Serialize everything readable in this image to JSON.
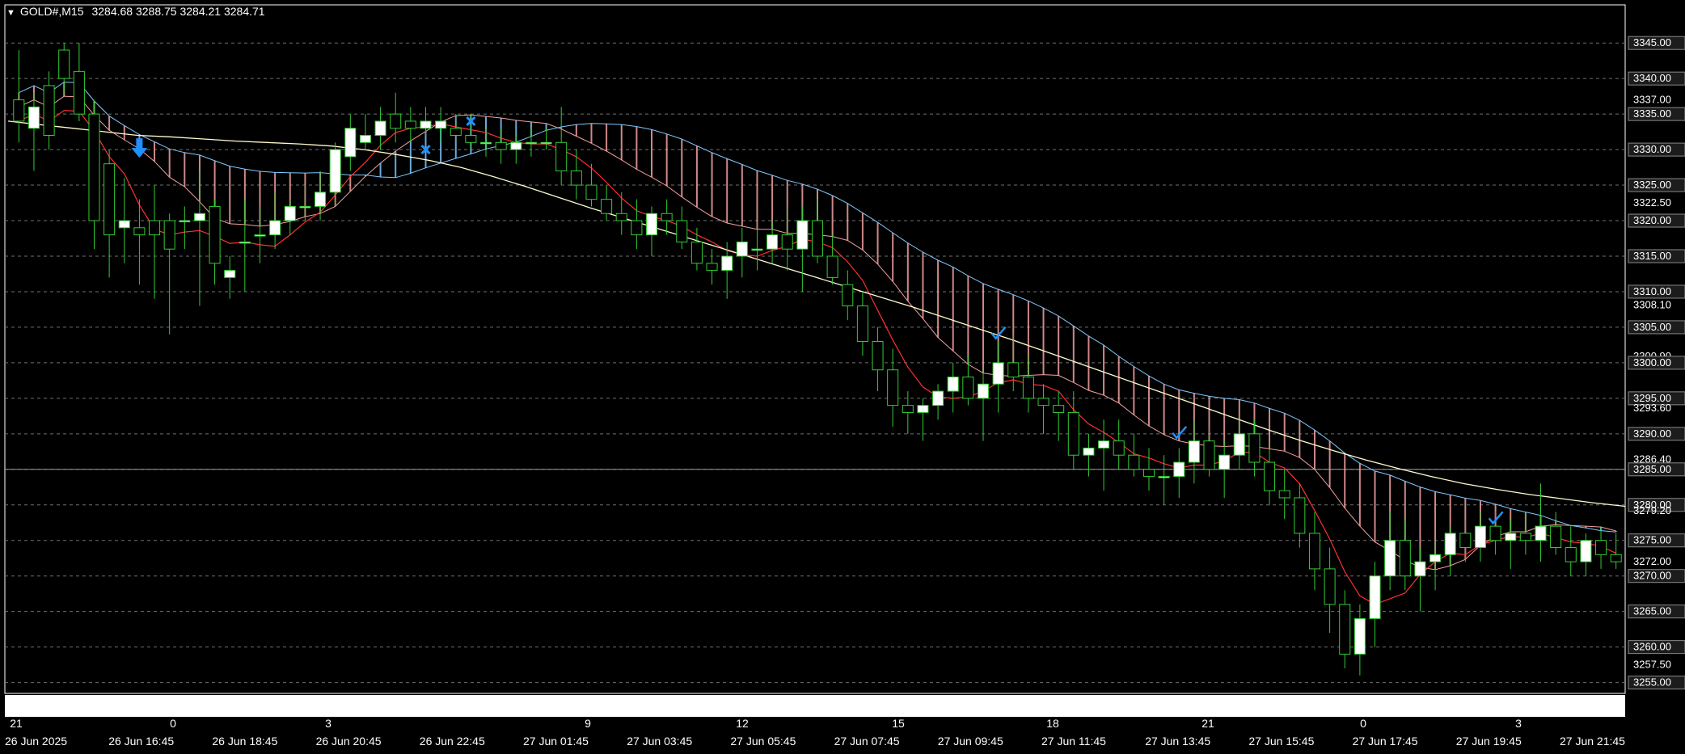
{
  "header": {
    "symbol": "GOLD#,M15",
    "open": "3284.68",
    "high": "3288.75",
    "low": "3284.21",
    "close": "3284.71"
  },
  "colors": {
    "background": "#000000",
    "frame": "#ffffff",
    "grid": "#6f6f6f",
    "bull_body": "#ffffff",
    "bear_body": "#000000",
    "wick": "#32cd32",
    "cloud_bear_fill": "#f4a0a0",
    "cloud_bull_fill": "#7ec8ff",
    "tenkan": "#ff3030",
    "slow_ma": "#fffacd",
    "arrow_signal": "#1e90ff"
  },
  "chart_data": {
    "type": "candlestick",
    "title": "",
    "ylim": [
      3254.5,
      3346.5
    ],
    "price_labels": [
      "3345.00",
      "3340.00",
      "3337.00",
      "3335.00",
      "3330.00",
      "3325.00",
      "3322.50",
      "3320.00",
      "3315.00",
      "3310.00",
      "3308.10",
      "3305.00",
      "3300.90",
      "3300.00",
      "3295.00",
      "3293.60",
      "3290.00",
      "3286.40",
      "3285.00",
      "3280.00",
      "3279.20",
      "3275.00",
      "3272.00",
      "3270.00",
      "3265.00",
      "3260.00",
      "3257.50",
      "3255.00"
    ],
    "grid_levels": [
      3345,
      3340,
      3335,
      3330,
      3325,
      3320,
      3315,
      3310,
      3305,
      3300,
      3295,
      3290,
      3285,
      3280,
      3275,
      3270,
      3265,
      3260,
      3255
    ],
    "current_price": 3285.0,
    "hour_labels": [
      "21",
      "0",
      "3",
      "9",
      "12",
      "15",
      "18",
      "21",
      "0",
      "3"
    ],
    "time_labels": [
      "26 Jun 2025",
      "26 Jun 16:45",
      "26 Jun 18:45",
      "26 Jun 20:45",
      "26 Jun 22:45",
      "27 Jun 01:45",
      "27 Jun 03:45",
      "27 Jun 05:45",
      "27 Jun 07:45",
      "27 Jun 09:45",
      "27 Jun 11:45",
      "27 Jun 13:45",
      "27 Jun 15:45",
      "27 Jun 17:45",
      "27 Jun 19:45",
      "27 Jun 21:45"
    ],
    "candles": [
      [
        3337,
        3344,
        3331,
        3334
      ],
      [
        3333,
        3338,
        3327,
        3336
      ],
      [
        3339,
        3341,
        3330,
        3332
      ],
      [
        3344,
        3345,
        3338,
        3340
      ],
      [
        3341,
        3345,
        3334,
        3335
      ],
      [
        3335,
        3337,
        3316,
        3320
      ],
      [
        3328,
        3330,
        3312,
        3318
      ],
      [
        3319,
        3326,
        3314,
        3320
      ],
      [
        3319,
        3323,
        3311,
        3318
      ],
      [
        3320,
        3325,
        3309,
        3318
      ],
      [
        3320,
        3321,
        3304,
        3316
      ],
      [
        3320,
        3322,
        3316,
        3320
      ],
      [
        3320,
        3327,
        3308,
        3321
      ],
      [
        3322,
        3323,
        3311,
        3314
      ],
      [
        3312,
        3315,
        3309,
        3313
      ],
      [
        3317,
        3323,
        3310,
        3317
      ],
      [
        3318,
        3322,
        3314,
        3318
      ],
      [
        3318,
        3324,
        3316,
        3320
      ],
      [
        3320,
        3323,
        3318,
        3322
      ],
      [
        3322,
        3325,
        3320,
        3322
      ],
      [
        3322,
        3327,
        3320,
        3324
      ],
      [
        3324,
        3331,
        3322,
        3330
      ],
      [
        3329,
        3335,
        3327,
        3333
      ],
      [
        3331,
        3335,
        3330,
        3332
      ],
      [
        3332,
        3336,
        3330,
        3334
      ],
      [
        3335,
        3338,
        3331,
        3333
      ],
      [
        3334,
        3336,
        3331,
        3333
      ],
      [
        3333,
        3336,
        3332,
        3334
      ],
      [
        3333,
        3336,
        3331,
        3334
      ],
      [
        3333,
        3335,
        3331,
        3332
      ],
      [
        3332,
        3335,
        3330,
        3331
      ],
      [
        3331,
        3333,
        3329,
        3331
      ],
      [
        3331,
        3333,
        3328,
        3330
      ],
      [
        3330,
        3332,
        3328,
        3331
      ],
      [
        3331,
        3333,
        3329,
        3331
      ],
      [
        3331,
        3333,
        3330,
        3331
      ],
      [
        3331,
        3336,
        3325,
        3327
      ],
      [
        3327,
        3330,
        3323,
        3325
      ],
      [
        3325,
        3328,
        3322,
        3323
      ],
      [
        3323,
        3325,
        3320,
        3321
      ],
      [
        3321,
        3324,
        3318,
        3320
      ],
      [
        3320,
        3323,
        3316,
        3318
      ],
      [
        3318,
        3322,
        3315,
        3321
      ],
      [
        3321,
        3323,
        3318,
        3320
      ],
      [
        3320,
        3322,
        3316,
        3317
      ],
      [
        3317,
        3319,
        3313,
        3314
      ],
      [
        3314,
        3316,
        3311,
        3313
      ],
      [
        3313,
        3317,
        3309,
        3315
      ],
      [
        3315,
        3319,
        3312,
        3317
      ],
      [
        3316,
        3320,
        3313,
        3316
      ],
      [
        3316,
        3320,
        3314,
        3318
      ],
      [
        3318,
        3322,
        3313,
        3316
      ],
      [
        3316,
        3322,
        3310,
        3320
      ],
      [
        3320,
        3323,
        3314,
        3315
      ],
      [
        3315,
        3318,
        3311,
        3312
      ],
      [
        3311,
        3313,
        3306,
        3308
      ],
      [
        3308,
        3310,
        3301,
        3303
      ],
      [
        3303,
        3305,
        3296,
        3299
      ],
      [
        3299,
        3302,
        3291,
        3294
      ],
      [
        3294,
        3296,
        3290,
        3293
      ],
      [
        3293,
        3295,
        3289,
        3294
      ],
      [
        3294,
        3297,
        3292,
        3296
      ],
      [
        3296,
        3300,
        3293,
        3298
      ],
      [
        3298,
        3301,
        3294,
        3295
      ],
      [
        3295,
        3299,
        3289,
        3297
      ],
      [
        3297,
        3303,
        3293,
        3300
      ],
      [
        3300,
        3304,
        3296,
        3298
      ],
      [
        3298,
        3301,
        3293,
        3295
      ],
      [
        3295,
        3297,
        3290,
        3294
      ],
      [
        3294,
        3296,
        3289,
        3293
      ],
      [
        3293,
        3296,
        3285,
        3287
      ],
      [
        3287,
        3290,
        3284,
        3288
      ],
      [
        3288,
        3292,
        3282,
        3289
      ],
      [
        3289,
        3292,
        3285,
        3287
      ],
      [
        3287,
        3290,
        3284,
        3285
      ],
      [
        3285,
        3288,
        3282,
        3284
      ],
      [
        3284,
        3287,
        3280,
        3284
      ],
      [
        3284,
        3288,
        3281,
        3286
      ],
      [
        3286,
        3292,
        3283,
        3289
      ],
      [
        3289,
        3291,
        3284,
        3285
      ],
      [
        3285,
        3289,
        3281,
        3287
      ],
      [
        3287,
        3292,
        3285,
        3290
      ],
      [
        3290,
        3292,
        3284,
        3286
      ],
      [
        3286,
        3289,
        3280,
        3282
      ],
      [
        3282,
        3285,
        3278,
        3281
      ],
      [
        3281,
        3283,
        3274,
        3276
      ],
      [
        3276,
        3279,
        3268,
        3271
      ],
      [
        3271,
        3274,
        3262,
        3266
      ],
      [
        3266,
        3268,
        3257,
        3259
      ],
      [
        3259,
        3266,
        3256,
        3264
      ],
      [
        3264,
        3272,
        3260,
        3270
      ],
      [
        3270,
        3279,
        3268,
        3275
      ],
      [
        3275,
        3278,
        3268,
        3270
      ],
      [
        3270,
        3274,
        3265,
        3272
      ],
      [
        3272,
        3275,
        3268,
        3273
      ],
      [
        3273,
        3277,
        3270,
        3276
      ],
      [
        3276,
        3278,
        3272,
        3274
      ],
      [
        3274,
        3279,
        3272,
        3277
      ],
      [
        3277,
        3279,
        3273,
        3275
      ],
      [
        3275,
        3278,
        3271,
        3276
      ],
      [
        3276,
        3279,
        3273,
        3275
      ],
      [
        3275,
        3283,
        3272,
        3277
      ],
      [
        3277,
        3279,
        3273,
        3274
      ],
      [
        3274,
        3277,
        3270,
        3272
      ],
      [
        3272,
        3276,
        3270,
        3275
      ],
      [
        3275,
        3277,
        3271,
        3273
      ],
      [
        3273,
        3276,
        3271,
        3272
      ]
    ],
    "slow_ma": [
      3334,
      3333.5,
      3333,
      3332.5,
      3332,
      3331.8,
      3331.5,
      3331.2,
      3331,
      3330.8,
      3330.5,
      3330,
      3329.3,
      3328.5,
      3327.5,
      3326.2,
      3324.8,
      3323.3,
      3321.8,
      3320.4,
      3319,
      3317.6,
      3316.2,
      3314.8,
      3313.4,
      3312,
      3310.6,
      3309.2,
      3307.8,
      3306.3,
      3304.8,
      3303.3,
      3301.7,
      3300.1,
      3298.5,
      3296.9,
      3295.3,
      3293.7,
      3292.1,
      3290.5,
      3289,
      3287.6,
      3286.3,
      3285.1,
      3284,
      3283,
      3282.2,
      3281.5,
      3280.9,
      3280.3,
      3279.8
    ],
    "series_lines": [
      "tenkan-sen",
      "kijun-sen",
      "senkou-span-a",
      "senkou-span-b",
      "moving-average"
    ]
  },
  "signals": {
    "down_arrow_icon": "arrow-down",
    "cross_icon": "cross",
    "check_icon": "check"
  }
}
